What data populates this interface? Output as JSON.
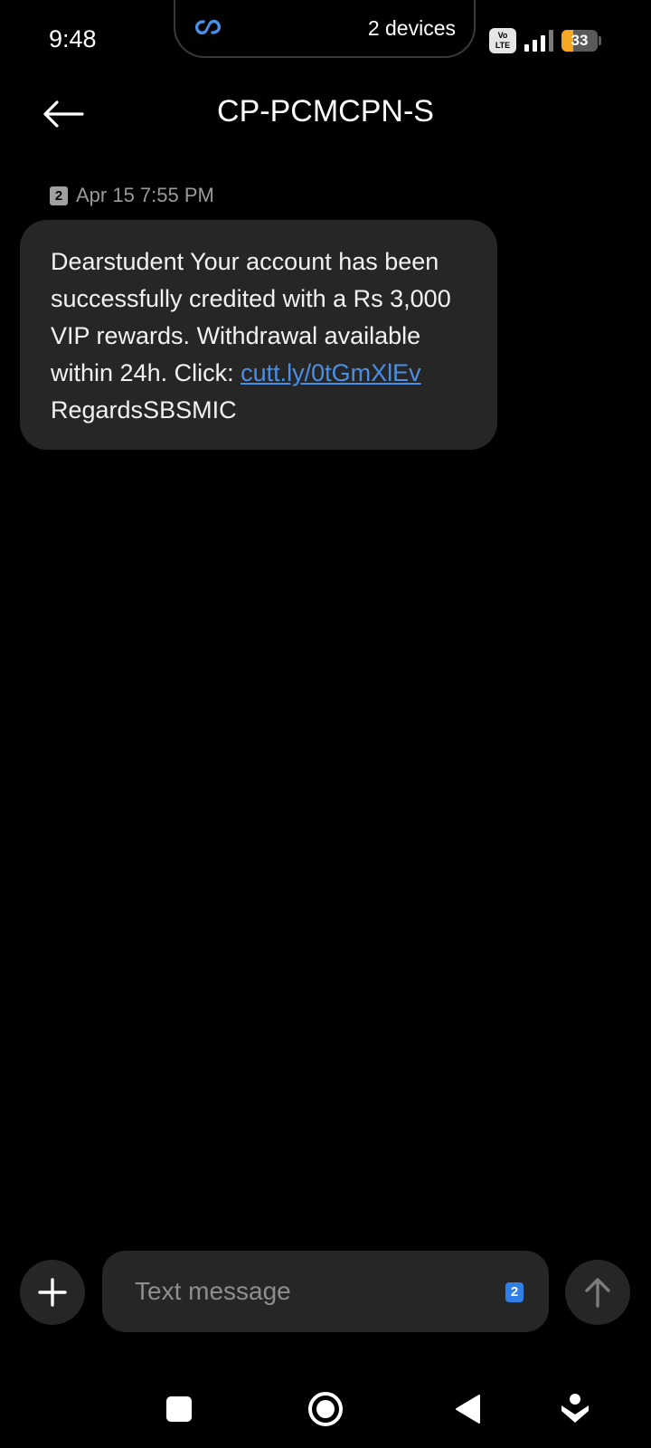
{
  "status_bar": {
    "time": "9:48",
    "island_label": "2 devices",
    "network_badge": "Vo LTE",
    "battery_level": "33",
    "battery_fraction": 0.33,
    "colors": {
      "battery_fill": "#f5a623",
      "link_icon": "#4a8fe7"
    }
  },
  "header": {
    "title": "CP-PCMCPN-S",
    "back_icon": "arrow-left-icon"
  },
  "messages": [
    {
      "sim": "2",
      "timestamp": "Apr 15 7:55 PM",
      "text_before_link": "Dearstudent Your account has been successfully credited with a Rs 3,000 VIP rewards. Withdrawal available within 24h. Click: ",
      "link": "cutt.ly/0tGmXlEv",
      "text_after_link": " RegardsSBSMIC"
    }
  ],
  "compose": {
    "placeholder": "Text message",
    "sim": "2",
    "attach_icon": "plus-icon",
    "send_icon": "arrow-up-icon"
  },
  "navigation": {
    "items": [
      "recents-square-icon",
      "home-circle-icon",
      "back-triangle-icon",
      "assistant-icon"
    ]
  },
  "colors": {
    "background": "#000000",
    "bubble": "#262626",
    "link": "#4a8fe7",
    "timestamp": "#9a9a9a",
    "compose_sim": "#2f7fe6"
  }
}
